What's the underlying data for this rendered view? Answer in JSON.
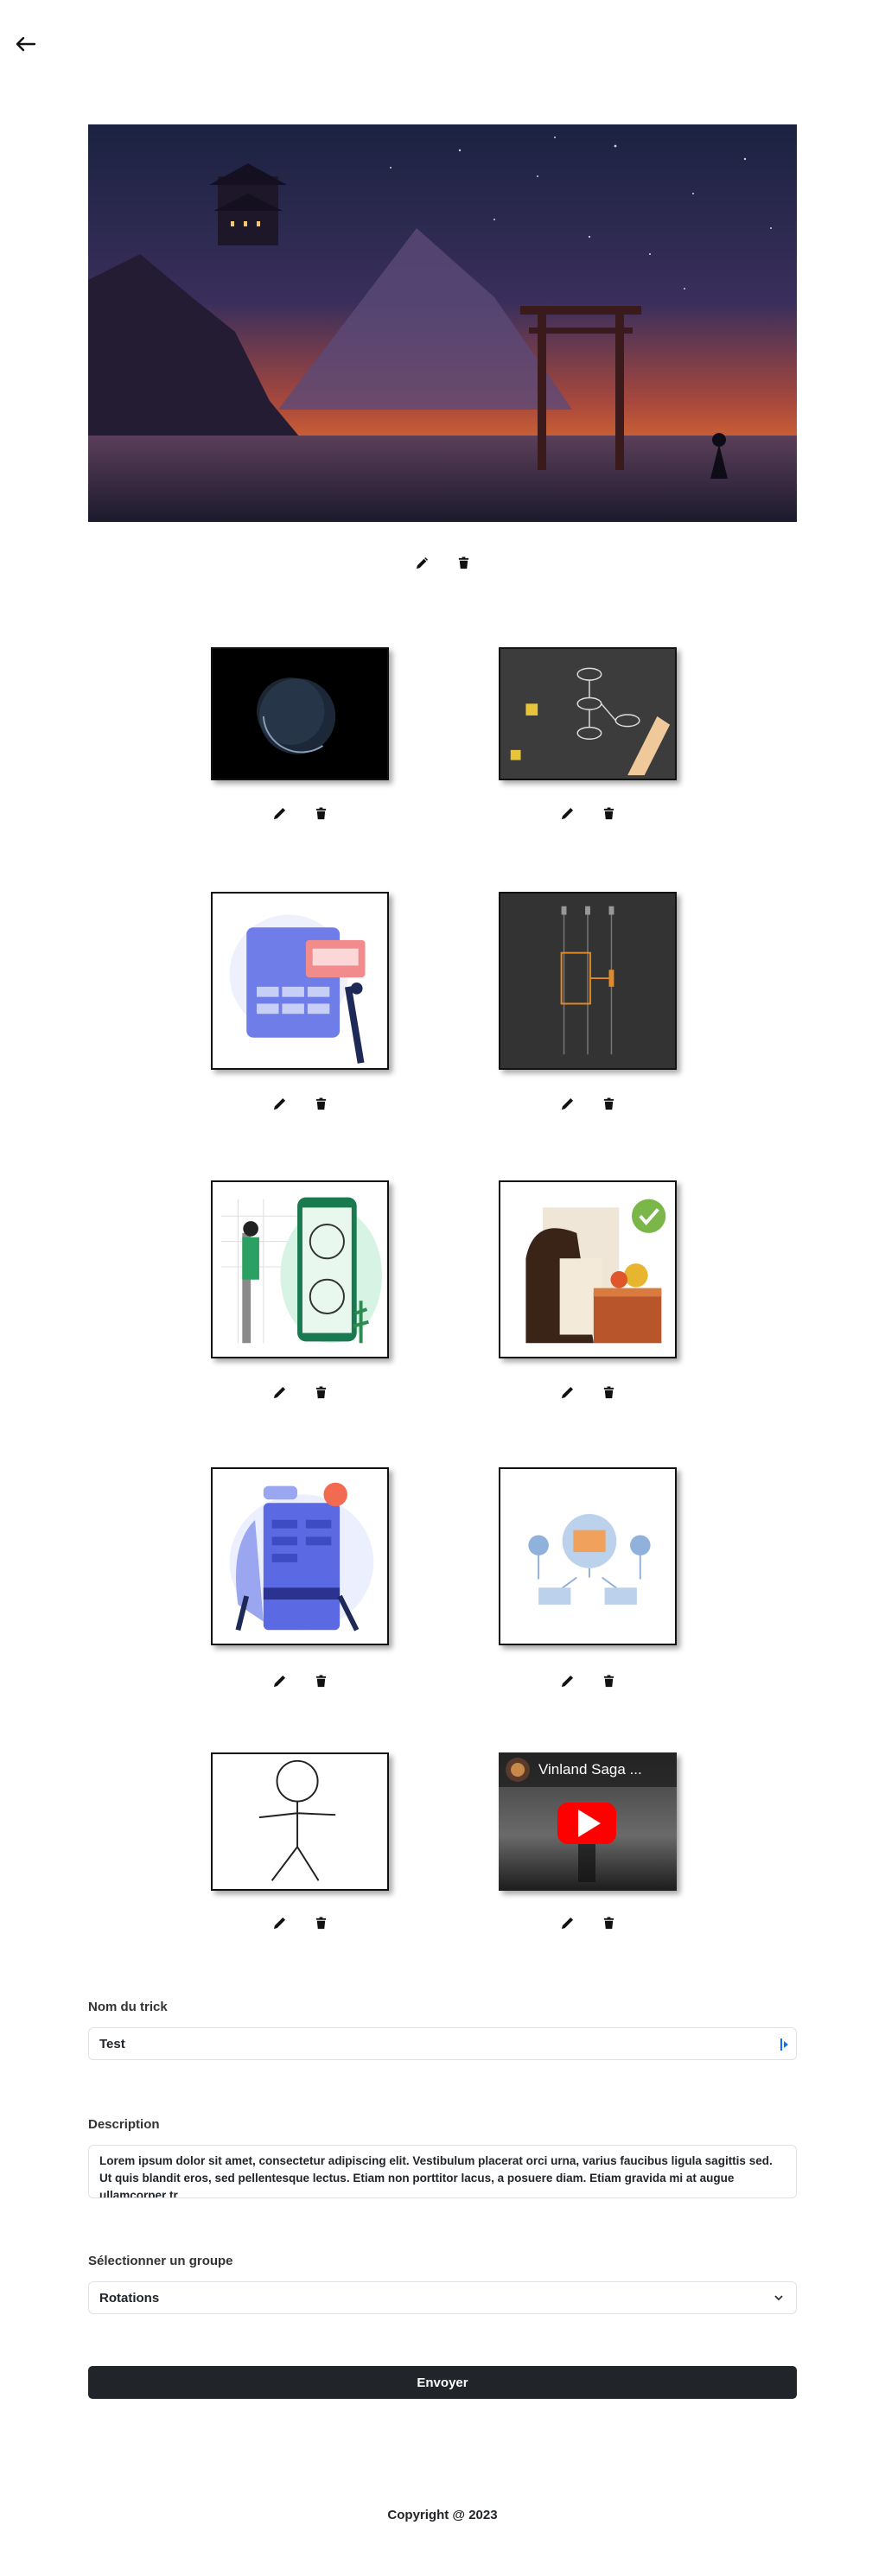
{
  "nav": {
    "back_icon": "arrow-left-icon"
  },
  "hero": {
    "image": "samurai-torii-night-landscape",
    "edit_icon": "pencil-icon",
    "delete_icon": "trash-icon"
  },
  "gallery": {
    "items": [
      {
        "image": "earth-in-space"
      },
      {
        "image": "flowchart-hands-board"
      },
      {
        "image": "form-illustration-purple"
      },
      {
        "image": "dark-timeline-diagram"
      },
      {
        "image": "mobile-app-user-illustration"
      },
      {
        "image": "person-with-box-checkmark"
      },
      {
        "image": "robot-machine-illustration"
      },
      {
        "image": "network-diagram-blue"
      },
      {
        "image": "stick-figure"
      },
      {
        "image": "youtube-video-thumbnail",
        "video_title": "Vinland Saga ..."
      }
    ]
  },
  "form": {
    "name_label": "Nom du trick",
    "name_value": "Test",
    "description_label": "Description",
    "description_value": "Lorem ipsum dolor sit amet, consectetur adipiscing elit. Vestibulum placerat orci urna, varius faucibus ligula sagittis sed. Ut quis blandit eros, sed pellentesque lectus. Etiam non porttitor lacus, a posuere diam. Etiam gravida mi at augue ullamcorper tr",
    "group_label": "Sélectionner un groupe",
    "group_value": "Rotations",
    "submit_label": "Envoyer"
  },
  "footer": {
    "copyright": "Copyright @ 2023"
  }
}
